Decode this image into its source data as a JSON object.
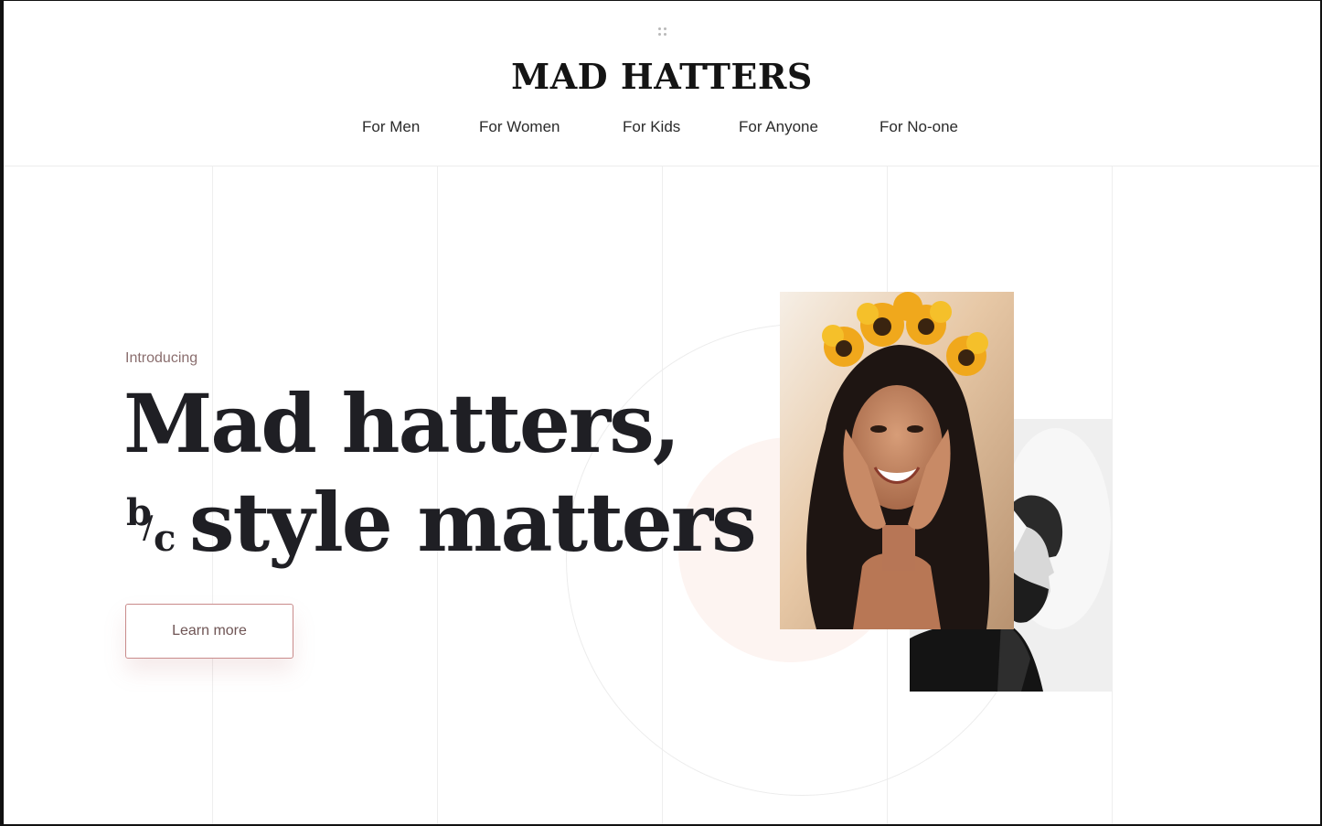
{
  "brand": {
    "name": "MAD HATTERS",
    "menu_icon": "drag-dots-icon"
  },
  "nav": {
    "items": [
      {
        "label": "For Men"
      },
      {
        "label": "For Women"
      },
      {
        "label": "For Kids"
      },
      {
        "label": "For Anyone"
      },
      {
        "label": "For No-one"
      }
    ]
  },
  "hero": {
    "eyebrow": "Introducing",
    "headline_line1": "Mad hatters,",
    "headline_prefix_b": "b",
    "headline_prefix_slash": "/",
    "headline_prefix_c": "c",
    "headline_line2": "style matters",
    "cta_label": "Learn more"
  },
  "colors": {
    "text_dark": "#1f1f24",
    "accent_muted": "#8a6e6e",
    "cta_border": "#c98b8b",
    "peach": "#fdf4f1",
    "grid_line": "#eeeeee"
  }
}
